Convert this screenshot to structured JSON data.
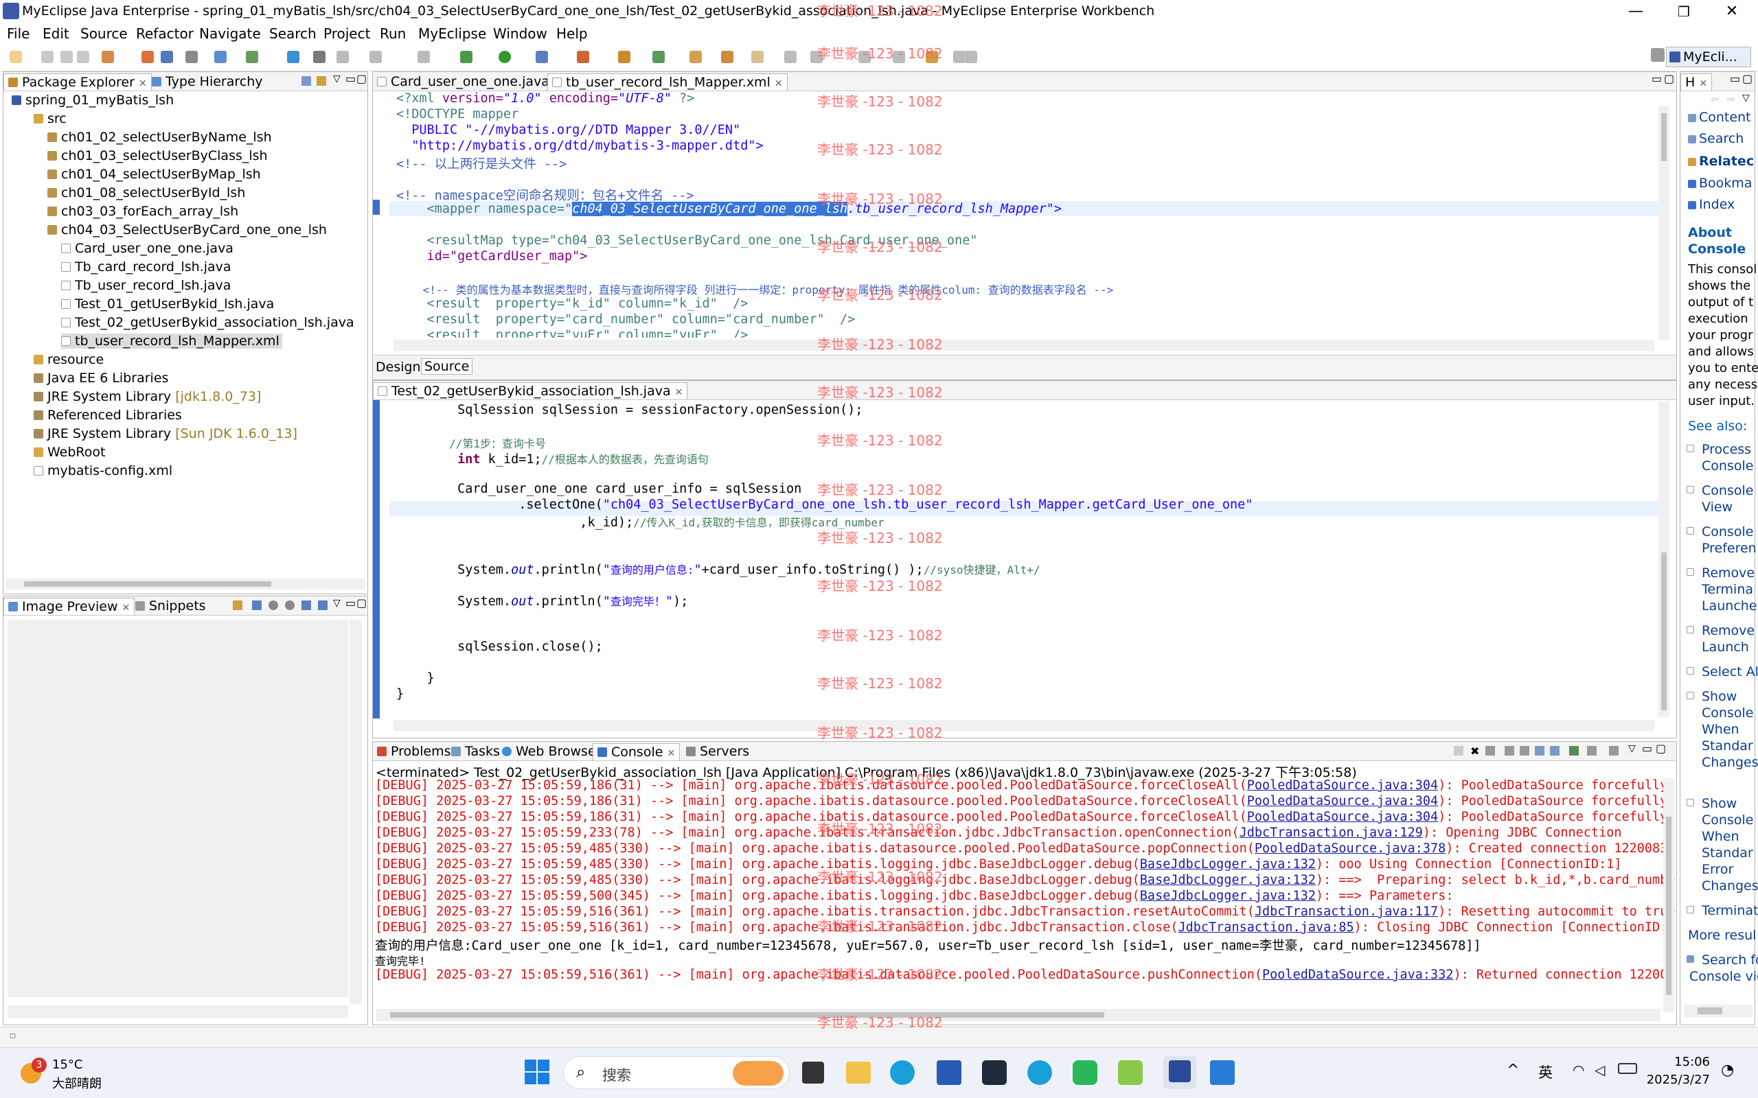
{
  "window": {
    "title": "MyEclipse Java Enterprise - spring_01_myBatis_lsh/src/ch04_03_SelectUserByCard_one_one_lsh/Test_02_getUserBykid_association_lsh.java - MyEclipse Enterprise Workbench",
    "minimize": "—",
    "maximize": "❐",
    "close": "✕"
  },
  "menu": [
    "File",
    "Edit",
    "Source",
    "Refactor",
    "Navigate",
    "Search",
    "Project",
    "Run",
    "MyEclipse",
    "Window",
    "Help"
  ],
  "perspective": "MyEcli...",
  "watermark": "李世豪 -123 - 1082",
  "package_explorer": {
    "tab1": "Package Explorer",
    "tab2": "Type Hierarchy",
    "items": [
      "spring_01_myBatis_lsh",
      "src",
      "ch01_02_selectUserByName_lsh",
      "ch01_03_selectUserByClass_lsh",
      "ch01_04_selectUserByMap_lsh",
      "ch01_08_selectUserById_lsh",
      "ch03_03_forEach_array_lsh",
      "ch04_03_SelectUserByCard_one_one_lsh",
      "Card_user_one_one.java",
      "Tb_card_record_lsh.java",
      "Tb_user_record_lsh.java",
      "Test_01_getUserBykid_lsh.java",
      "Test_02_getUserBykid_association_lsh.java",
      "tb_user_record_lsh_Mapper.xml",
      "resource",
      "Java EE 6 Libraries",
      "JRE System Library",
      "Referenced Libraries",
      "JRE System Library",
      "WebRoot",
      "mybatis-config.xml"
    ],
    "jre1_suffix": "[jdk1.8.0_73]",
    "jre2_suffix": "[Sun JDK 1.6.0_13]"
  },
  "image_preview": {
    "tab1": "Image Preview",
    "tab2": "Snippets"
  },
  "xml_editor": {
    "tab1": "Card_user_one_one.java",
    "tab2": "tb_user_record_lsh_Mapper.xml",
    "lines": [
      "<?xml version=\"1.0\" encoding=\"UTF-8\" ?>",
      "<!DOCTYPE mapper",
      "  PUBLIC \"-//mybatis.org//DTD Mapper 3.0//EN\"",
      "  \"http://mybatis.org/dtd/mybatis-3-mapper.dtd\">",
      "<!-- 以上两行是头文件 -->",
      "",
      "<!-- namespace空间命名规则：包名+文件名 -->",
      "    <mapper namespace=\"",
      "",
      "    <resultMap type=\"ch04_03_SelectUserByCard_one_one_lsh.Card_user_one_one\"",
      "    id=\"getCardUser_map\">",
      "",
      "    <!-- 类的属性为基本数据类型时，直接与查询所得字段 列进行一一绑定：property: 属性指 类的属性colum: 查询的数据表字段名 -->",
      "    <result  property=\"k_id\" column=\"k_id\"  />",
      "    <result  property=\"card_number\" column=\"card_number\"  />",
      "    <result  property=\"yuEr\" column=\"yuEr\"  />"
    ],
    "namespace_selected": "ch04_03_SelectUserByCard_one_one_lsh",
    "namespace_rest": ".tb_user_record_lsh_Mapper\">",
    "design_tab": "Design",
    "source_tab": "Source"
  },
  "java_editor": {
    "tab": "Test_02_getUserBykid_association_lsh.java",
    "lines": [
      "        SqlSession sqlSession = sessionFactory.openSession();",
      "",
      "        //第1步：查询卡号",
      "        int k_id=1;//根据本人的数据表，先查询语句",
      "",
      "        Card_user_one_one card_user_info = sqlSession",
      "                .selectOne(\"ch04_03_SelectUserByCard_one_one_lsh.tb_user_record_lsh_Mapper.getCard_User_one_one\"",
      "                        ,k_id);//传入K_id,获取的卡信息，即获得card_number",
      "",
      "",
      "        System.out.println(\"查询的用户信息:\"+card_user_info.toString() );//syso快捷键，Alt+/",
      "",
      "        System.out.println(\"查询完毕！\");",
      "",
      "",
      "        sqlSession.close();",
      "",
      "    }",
      "}"
    ]
  },
  "console": {
    "tabs": [
      "Problems",
      "Tasks",
      "Web Browser",
      "Console",
      "Servers"
    ],
    "header": "<terminated> Test_02_getUserBykid_association_lsh [Java Application] C:\\Program Files (x86)\\Java\\jdk1.8.0_73\\bin\\javaw.exe (2025-3-27 下午3:05:58)",
    "lines": [
      {
        "pre": "[DEBUG] 2025-03-27 15:05:59,186(31) --> [main] org.apache.ibatis.datasource.pooled.PooledDataSource.forceCloseAll(",
        "link": "PooledDataSource.java:304",
        "post": "): PooledDataSource forcefully"
      },
      {
        "pre": "[DEBUG] 2025-03-27 15:05:59,186(31) --> [main] org.apache.ibatis.datasource.pooled.PooledDataSource.forceCloseAll(",
        "link": "PooledDataSource.java:304",
        "post": "): PooledDataSource forcefully"
      },
      {
        "pre": "[DEBUG] 2025-03-27 15:05:59,186(31) --> [main] org.apache.ibatis.datasource.pooled.PooledDataSource.forceCloseAll(",
        "link": "PooledDataSource.java:304",
        "post": "): PooledDataSource forcefully"
      },
      {
        "pre": "[DEBUG] 2025-03-27 15:05:59,233(78) --> [main] org.apache.ibatis.transaction.jdbc.JdbcTransaction.openConnection(",
        "link": "JdbcTransaction.java:129",
        "post": "): Opening JDBC Connection"
      },
      {
        "pre": "[DEBUG] 2025-03-27 15:05:59,485(330) --> [main] org.apache.ibatis.datasource.pooled.PooledDataSource.popConnection(",
        "link": "PooledDataSource.java:378",
        "post": "): Created connection 12200838"
      },
      {
        "pre": "[DEBUG] 2025-03-27 15:05:59,485(330) --> [main] org.apache.ibatis.logging.jdbc.BaseJdbcLogger.debug(",
        "link": "BaseJdbcLogger.java:132",
        "post": "): ooo Using Connection [ConnectionID:1]"
      },
      {
        "pre": "[DEBUG] 2025-03-27 15:05:59,485(330) --> [main] org.apache.ibatis.logging.jdbc.BaseJdbcLogger.debug(",
        "link": "BaseJdbcLogger.java:132",
        "post": "): ==>  Preparing: select b.k_id,*,b.card_numbe"
      },
      {
        "pre": "[DEBUG] 2025-03-27 15:05:59,500(345) --> [main] org.apache.ibatis.logging.jdbc.BaseJdbcLogger.debug(",
        "link": "BaseJdbcLogger.java:132",
        "post": "): ==> Parameters:"
      },
      {
        "pre": "[DEBUG] 2025-03-27 15:05:59,516(361) --> [main] org.apache.ibatis.transaction.jdbc.JdbcTransaction.resetAutoCommit(",
        "link": "JdbcTransaction.java:117",
        "post": "): Resetting autocommit to true"
      },
      {
        "pre": "[DEBUG] 2025-03-27 15:05:59,516(361) --> [main] org.apache.ibatis.transaction.jdbc.JdbcTransaction.close(",
        "link": "JdbcTransaction.java:85",
        "post": "): Closing JDBC Connection [ConnectionID:1"
      },
      {
        "pre": "[DEBUG] 2025-03-27 15:05:59,516(361) --> [main] org.apache.ibatis.datasource.pooled.PooledDataSource.pushConnection(",
        "link": "PooledDataSource.java:332",
        "post": "): Returned connection 122008"
      }
    ],
    "output1": "查询的用户信息:Card_user_one_one [k_id=1, card_number=12345678, yuEr=567.0, user=Tb_user_record_lsh [sid=1, user_name=李世豪, card_number=12345678]]",
    "output2": "查询完毕!"
  },
  "help": {
    "tab": "H",
    "links": [
      "Content",
      "Search",
      "Relatec",
      "Bookma",
      "Index"
    ],
    "about_title": "About",
    "about_title2": "Console",
    "about_text": [
      "This consol",
      "shows the",
      "output of t",
      "execution",
      "your progr",
      "and allows",
      "you to ente",
      "any necess",
      "user input."
    ],
    "see_also": "See also:",
    "see_items": [
      [
        "Process",
        "Console"
      ],
      [
        "Console",
        "View"
      ],
      [
        "Console",
        "Preferen"
      ],
      [
        "Remove",
        "Termina",
        "Launche"
      ],
      [
        "Remove",
        "Launch"
      ],
      [
        "Select Al"
      ],
      [
        "Show",
        "Console",
        "When",
        "Standar",
        "Changes"
      ],
      [
        "Show",
        "Console",
        "When",
        "Standar",
        "Error",
        "Changes"
      ],
      [
        "Terminat"
      ]
    ],
    "more": "More resul",
    "search_footer": [
      "Search fo",
      "Console vie"
    ]
  },
  "taskbar": {
    "weather_temp": "15°C",
    "weather_desc": "大部晴朗",
    "weather_badge": "3",
    "search_placeholder": "搜索",
    "ime": "英",
    "time": "15:06",
    "date": "2025/3/27"
  }
}
